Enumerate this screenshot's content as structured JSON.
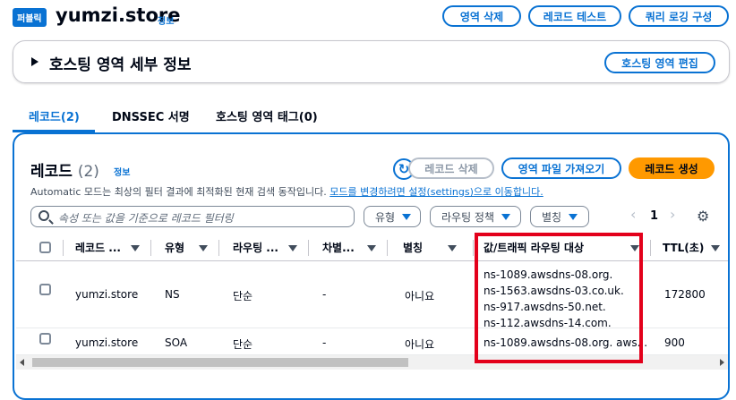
{
  "header": {
    "badge": "퍼블릭",
    "title": "yumzi.store",
    "info": "정보",
    "buttons": [
      "영역 삭제",
      "레코드 테스트",
      "쿼리 로깅 구성"
    ]
  },
  "details": {
    "title": "호스팅 영역 세부 정보",
    "edit_button": "호스팅 영역 편집"
  },
  "tabs": [
    "레코드(2)",
    "DNSSEC 서명",
    "호스팅 영역 태그(0)"
  ],
  "records_panel": {
    "title": "레코드",
    "count": "(2)",
    "info": "정보",
    "refresh_icon": "↻",
    "delete_button": "레코드 삭제",
    "import_button": "영역 파일 가져오기",
    "create_button": "레코드 생성",
    "description": "Automatic 모드는 최상의 필터 결과에 최적화된 현재 검색 동작입니다.",
    "description_link": "모드를 변경하려면 설정(settings)으로 이동합니다.",
    "search_placeholder": "속성 또는 값을 기준으로 레코드 필터링",
    "filters": [
      "유형",
      "라우팅 정책",
      "별칭"
    ],
    "page": "1",
    "prev_icon": "‹",
    "next_icon": "›",
    "settings_icon": "⚙"
  },
  "table": {
    "columns": [
      "레코드 ...",
      "유형",
      "라우팅 ...",
      "차별...",
      "별칭",
      "값/트래픽 라우팅 대상",
      "TTL(초)"
    ],
    "rows": [
      {
        "name": "yumzi.store",
        "type": "NS",
        "routing": "단순",
        "diff": "-",
        "alias": "아니요",
        "values": [
          "ns-1089.awsdns-08.org.",
          "ns-1563.awsdns-03.co.uk.",
          "ns-917.awsdns-50.net.",
          "ns-112.awsdns-14.com."
        ],
        "ttl": "172800"
      },
      {
        "name": "yumzi.store",
        "type": "SOA",
        "routing": "단순",
        "diff": "-",
        "alias": "아니요",
        "values": [
          "ns-1089.awsdns-08.org. aws..."
        ],
        "ttl": "900"
      }
    ]
  },
  "colors": {
    "accent": "#0972d3",
    "primary_button": "#ff9900",
    "highlight": "#e3001b"
  }
}
